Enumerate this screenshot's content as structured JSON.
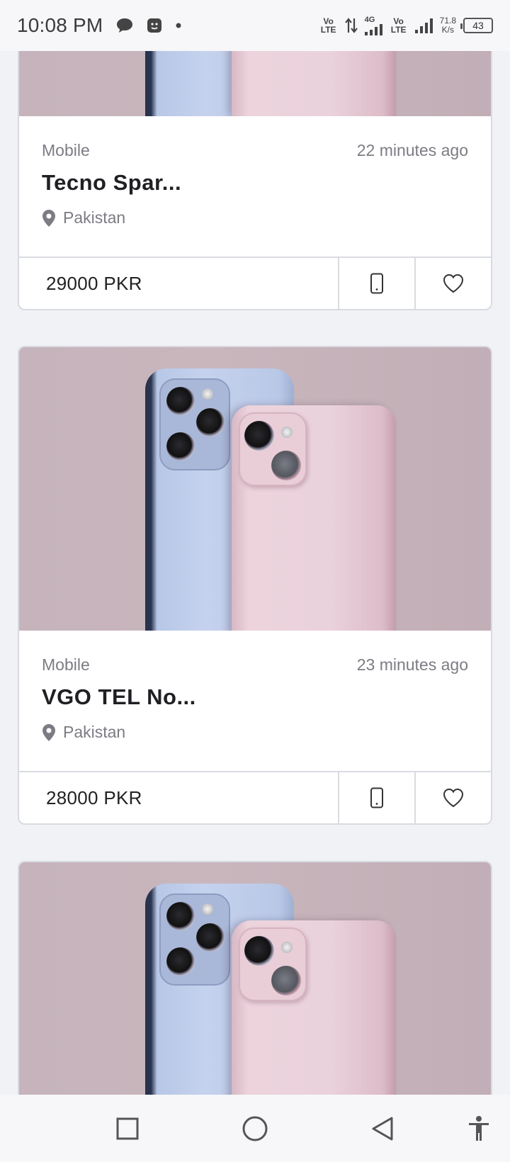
{
  "status_bar": {
    "time": "10:08 PM",
    "left_icons": [
      "chat-bubble-icon",
      "messenger-face-icon",
      "notification-dot-icon"
    ],
    "net1": "Vo LTE",
    "net2": "4G",
    "net3": "Vo LTE",
    "speed_value": "71.8",
    "speed_unit": "K/s",
    "battery": "43"
  },
  "listings": [
    {
      "category": "Mobile",
      "time_ago": "22 minutes ago",
      "title": "Tecno Spar...",
      "location": "Pakistan",
      "price": "29000 PKR"
    },
    {
      "category": "Mobile",
      "time_ago": "23 minutes ago",
      "title": "VGO TEL No...",
      "location": "Pakistan",
      "price": "28000 PKR"
    },
    {
      "category": "",
      "time_ago": "",
      "title": "",
      "location": "",
      "price": ""
    }
  ],
  "nav_bar": {
    "icons": [
      "recents-square-icon",
      "home-circle-icon",
      "back-triangle-icon",
      "accessibility-icon"
    ]
  },
  "colors": {
    "background": "#f1f2f6",
    "card_border": "#d9dbe1",
    "text_primary": "#1f1f24",
    "text_secondary": "#7c7c84"
  }
}
